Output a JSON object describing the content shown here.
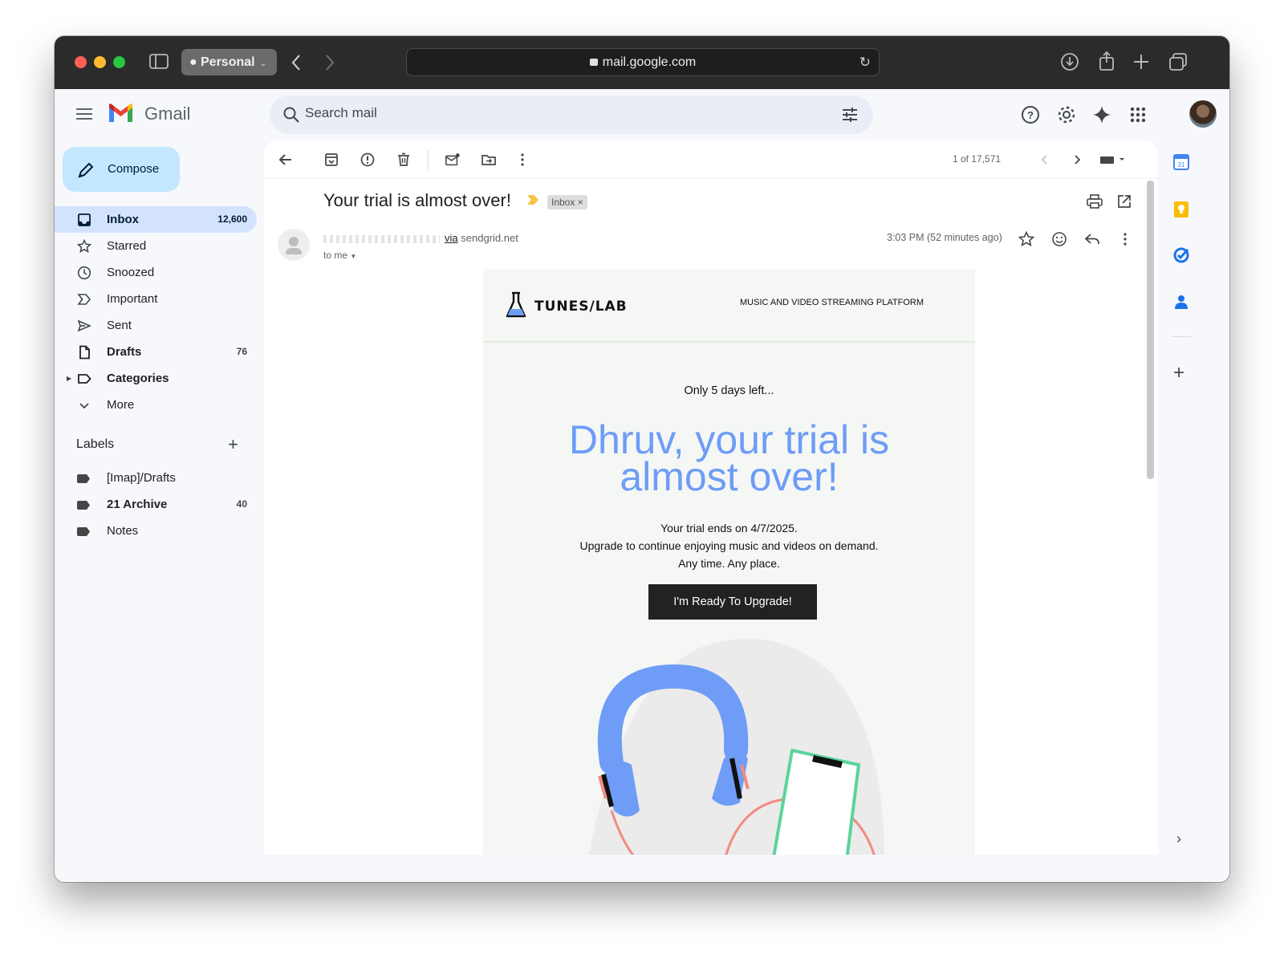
{
  "browser": {
    "profile_label": "Personal",
    "url": "mail.google.com"
  },
  "app": {
    "name": "Gmail",
    "search_placeholder": "Search mail"
  },
  "sidebar": {
    "compose_label": "Compose",
    "items": [
      {
        "label": "Inbox",
        "count": "12,600",
        "icon": "inbox-icon"
      },
      {
        "label": "Starred",
        "count": "",
        "icon": "star-icon"
      },
      {
        "label": "Snoozed",
        "count": "",
        "icon": "clock-icon"
      },
      {
        "label": "Important",
        "count": "",
        "icon": "important-icon"
      },
      {
        "label": "Sent",
        "count": "",
        "icon": "send-icon"
      },
      {
        "label": "Drafts",
        "count": "76",
        "icon": "draft-icon"
      },
      {
        "label": "Categories",
        "count": "",
        "icon": "label-outline-icon"
      },
      {
        "label": "More",
        "count": "",
        "icon": "chevron-down-icon"
      }
    ],
    "labels_heading": "Labels",
    "labels": [
      {
        "label": "[Imap]/Drafts",
        "count": ""
      },
      {
        "label": "21 Archive",
        "count": "40"
      },
      {
        "label": "Notes",
        "count": ""
      }
    ]
  },
  "toolbar": {
    "pager": "1 of 17,571"
  },
  "message": {
    "subject": "Your trial is almost over!",
    "inbox_chip": "Inbox ×",
    "via_label": "via",
    "via_domain": "sendgrid.net",
    "to_me": "to me",
    "timestamp": "3:03 PM (52 minutes ago)"
  },
  "email": {
    "brand": "TUNES/LAB",
    "tagline": "MUSIC AND VIDEO STREAMING PLATFORM",
    "days_left": "Only 5 days left...",
    "headline_line1": "Dhruv, your trial is",
    "headline_line2": "almost over!",
    "body_line1": "Your trial ends on 4/7/2025.",
    "body_line2": "Upgrade to continue enjoying music and videos on demand.",
    "body_line3": "Any time. Any place.",
    "cta_label": "I'm Ready To Upgrade!"
  },
  "colors": {
    "accent_blue": "#6e9cf7",
    "compose_bg": "#c2e7ff",
    "active_nav_bg": "#d3e3fd",
    "cta_bg": "#222222"
  }
}
